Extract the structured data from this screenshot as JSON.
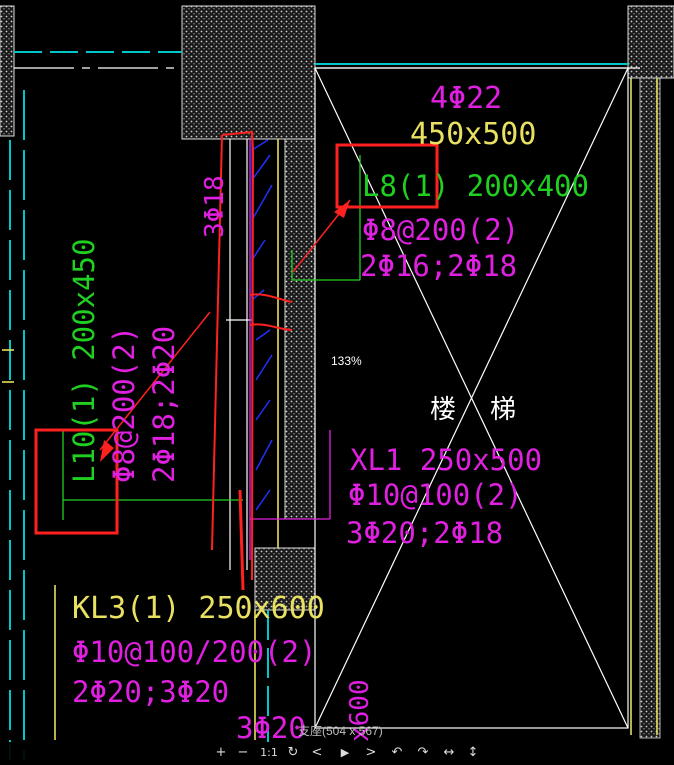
{
  "viewer": {
    "zoom_label": "133%",
    "status_text": "支座(504 x 567)"
  },
  "toolbar": {
    "buttons": [
      {
        "name": "zoom-in-button",
        "glyph": "+"
      },
      {
        "name": "zoom-out-button",
        "glyph": "−"
      },
      {
        "name": "actual-size-button",
        "glyph": "1:1"
      },
      {
        "name": "refresh-button",
        "glyph": "↻"
      },
      {
        "name": "previous-button",
        "glyph": "<"
      },
      {
        "name": "play-button",
        "glyph": "▶"
      },
      {
        "name": "next-button",
        "glyph": ">"
      },
      {
        "name": "rotate-left-button",
        "glyph": "↶"
      },
      {
        "name": "rotate-right-button",
        "glyph": "↷"
      },
      {
        "name": "flip-horizontal-button",
        "glyph": "↔"
      },
      {
        "name": "flip-vertical-button",
        "glyph": "↕"
      }
    ]
  },
  "annotations": {
    "top_beam_bars": "4Φ22",
    "top_beam_size": "450x500",
    "l8_label": "L8(1) 200x400",
    "l8_stirrup": "Φ8@200(2)",
    "l8_bars": "2Φ16;2Φ18",
    "left_rebar": "3Φ18",
    "l10_label": "L10(1) 200x450",
    "l10_stirrup": "Φ8@200(2)",
    "l10_bars": "2Φ18;2Φ20",
    "stair_label_1": "楼",
    "stair_label_2": "梯",
    "xl1_label": "XL1 250x500",
    "xl1_stirrup": "Φ10@100(2)",
    "xl1_bars": "3Φ20;2Φ18",
    "kl3_label": "KL3(1) 250x600",
    "kl3_stirrup": "Φ10@100/200(2)",
    "kl3_bars": "2Φ20;3Φ20",
    "bottom_bars": "3Φ20",
    "bottom_dim": "x600"
  },
  "colors": {
    "background": "#000000",
    "cyan": "#00c8c8",
    "magenta": "#e020e0",
    "green": "#20d020",
    "yellow": "#e8e060",
    "white": "#ffffff",
    "red_markup": "#ff2020",
    "blue_hatch": "#2030ff"
  }
}
